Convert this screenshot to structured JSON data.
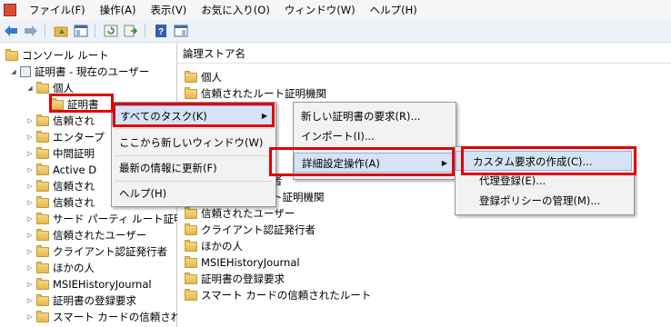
{
  "menubar": {
    "items": [
      "ファイル(F)",
      "操作(A)",
      "表示(V)",
      "お気に入り(O)",
      "ウィンドウ(W)",
      "ヘルプ(H)"
    ]
  },
  "tree": {
    "console_root": "コンソール ルート",
    "cert_current_user": "証明書 - 現在のユーザー",
    "personal": "個人",
    "personal_certs": "証明書",
    "trusted_root": "信頼され",
    "enterprise": "エンタープ",
    "intermediate": "中間証明",
    "active_directory": "Active D",
    "trusted_2": "信頼され",
    "trusted_3": "信頼され",
    "third_party_root": "サード パーティ ルート証明機関",
    "trusted_users": "信頼されたユーザー",
    "client_auth": "クライアント認証発行者",
    "other_people": "ほかの人",
    "msie": "MSIEHistoryJournal",
    "cert_enrollment": "証明書の登録要求",
    "smartcard": "スマート カードの信頼されたル"
  },
  "right_panel": {
    "column_header": "論理ストア名",
    "items": [
      "個人",
      "信頼されたルート証明機関",
      "者",
      "ト証明機関",
      "信頼されたユーザー",
      "クライアント認証発行者",
      "ほかの人",
      "MSIEHistoryJournal",
      "証明書の登録要求",
      "スマート カードの信頼されたルート"
    ]
  },
  "context_menu": {
    "all_tasks": "すべてのタスク(K)",
    "new_window": "ここから新しいウィンドウ(W)",
    "refresh": "最新の情報に更新(F)",
    "help": "ヘルプ(H)"
  },
  "submenu_tasks": {
    "request_new": "新しい証明書の要求(R)...",
    "import": "インポート(I)...",
    "advanced": "詳細設定操作(A)"
  },
  "submenu_advanced": {
    "custom_request": "カスタム要求の作成(C)...",
    "enroll_on_behalf": "代理登録(E)...",
    "manage_policies": "登録ポリシーの管理(M)..."
  },
  "colors": {
    "highlight_outline": "#e0000a",
    "menu_hover": "#d5e3f5"
  }
}
